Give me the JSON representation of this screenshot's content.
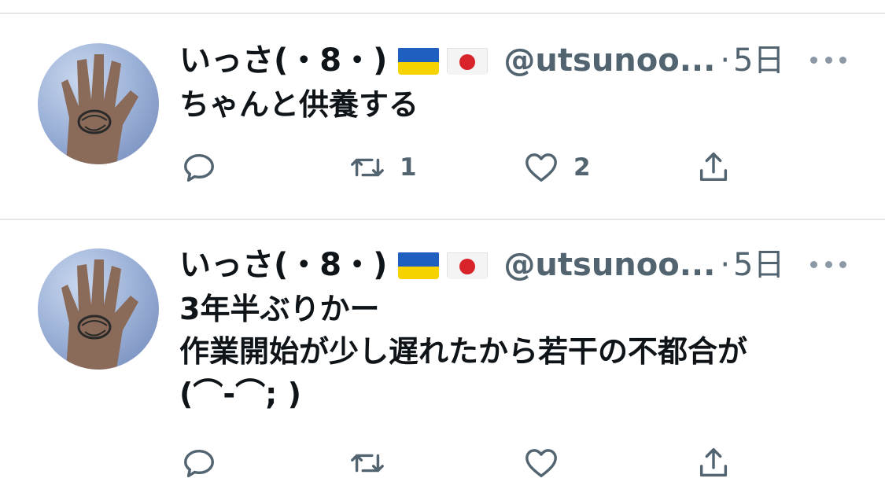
{
  "tweets": [
    {
      "display_name": "いっさ(・8・)",
      "flags": [
        "ukraine-flag",
        "japan-flag"
      ],
      "handle": "@utsunoo...",
      "separator": "·",
      "time": "5日",
      "lines": [
        "ちゃんと供養する"
      ],
      "actions": {
        "reply_count": "",
        "retweet_count": "1",
        "like_count": "2"
      }
    },
    {
      "display_name": "いっさ(・8・)",
      "flags": [
        "ukraine-flag",
        "japan-flag"
      ],
      "handle": "@utsunoo...",
      "separator": "·",
      "time": "5日",
      "lines": [
        "3年半ぶりかー",
        "作業開始が少し遅れたから若干の不都合が",
        "(⌒-⌒; )"
      ],
      "actions": {
        "reply_count": "",
        "retweet_count": "",
        "like_count": ""
      }
    }
  ],
  "colors": {
    "text_primary": "#0f1419",
    "text_secondary": "#536471",
    "divider": "#e4e7ea",
    "ukraine_blue": "#1f5fbf",
    "ukraine_yellow": "#f5d200",
    "japan_red": "#d8232a"
  }
}
